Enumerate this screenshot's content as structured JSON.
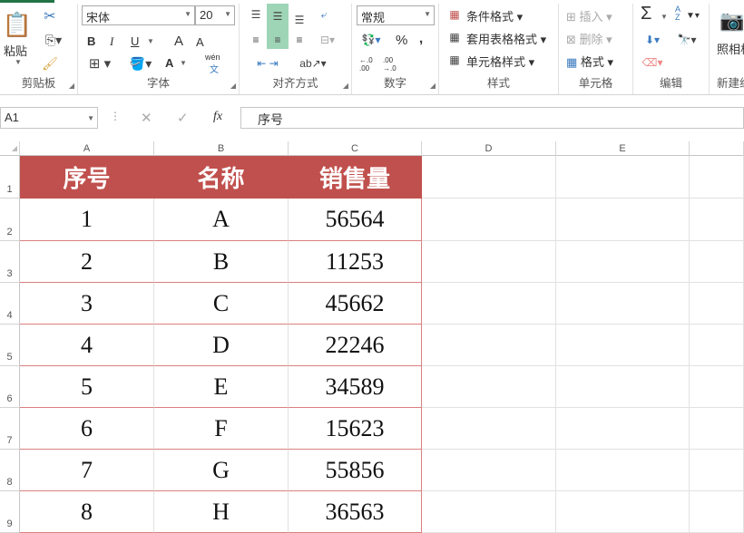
{
  "ribbon": {
    "clipboard": {
      "paste": "粘贴",
      "label": "剪贴板"
    },
    "font": {
      "name": "宋体",
      "size": "20",
      "bold": "B",
      "italic": "I",
      "underline": "U",
      "grow": "A",
      "shrink": "A",
      "font_color": "A",
      "phonetic": "wén",
      "phonetic_char": "文",
      "label": "字体"
    },
    "alignment": {
      "label": "对齐方式"
    },
    "number": {
      "format": "常规",
      "percent": "%",
      "comma": ",",
      "inc_decimal": "←.0 .00",
      "dec_decimal": ".00 →.0",
      "label": "数字"
    },
    "styles": {
      "conditional": "条件格式",
      "table": "套用表格格式",
      "cell": "单元格样式",
      "label": "样式"
    },
    "cells": {
      "insert": "插入",
      "delete": "删除",
      "format": "格式",
      "label": "单元格"
    },
    "editing": {
      "sum": "Σ",
      "sort": "A Z",
      "label": "编辑"
    },
    "camera": {
      "label": "照相机",
      "group": "新建组"
    }
  },
  "formula_bar": {
    "name_box": "A1",
    "cancel": "✕",
    "enter": "✓",
    "fx": "fx",
    "value": "序号"
  },
  "columns": [
    "A",
    "B",
    "C",
    "D",
    "E"
  ],
  "rows": [
    "1",
    "2",
    "3",
    "4",
    "5",
    "6",
    "7",
    "8",
    "9"
  ],
  "table": {
    "headers": [
      "序号",
      "名称",
      "销售量"
    ],
    "data": [
      [
        "1",
        "A",
        "56564"
      ],
      [
        "2",
        "B",
        "11253"
      ],
      [
        "3",
        "C",
        "45662"
      ],
      [
        "4",
        "D",
        "22246"
      ],
      [
        "5",
        "E",
        "34589"
      ],
      [
        "6",
        "F",
        "15623"
      ],
      [
        "7",
        "G",
        "55856"
      ],
      [
        "8",
        "H",
        "36563"
      ]
    ]
  },
  "colors": {
    "header_fill": "#c0504d",
    "accent": "#217346"
  }
}
